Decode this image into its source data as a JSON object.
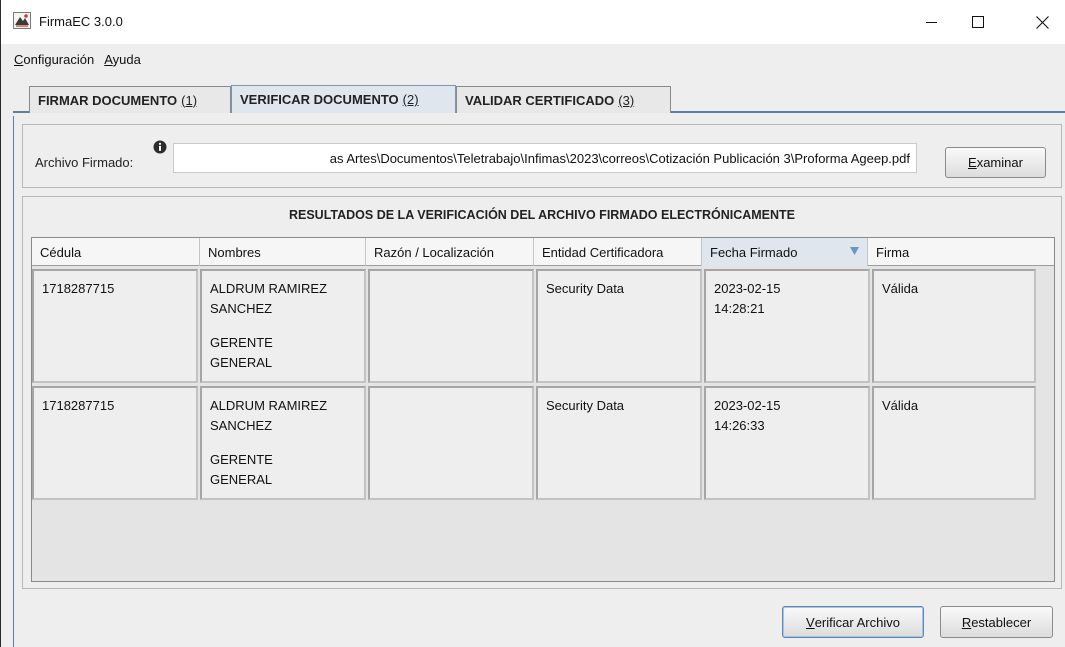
{
  "window": {
    "title": "FirmaEC 3.0.0"
  },
  "menu": {
    "items": [
      {
        "label_u": "C",
        "label_rest": "onfiguración"
      },
      {
        "label_u": "A",
        "label_rest": "yuda"
      }
    ]
  },
  "tabs": [
    {
      "label": "FIRMAR DOCUMENTO",
      "shortcut": "(1)"
    },
    {
      "label": "VERIFICAR DOCUMENTO",
      "shortcut": "(2)"
    },
    {
      "label": "VALIDAR CERTIFICADO",
      "shortcut": "(3)"
    }
  ],
  "file": {
    "label": "Archivo Firmado:",
    "value": "as Artes\\Documentos\\Teletrabajo\\Infimas\\2023\\correos\\Cotización Publicación 3\\Proforma Ageep.pdf",
    "browse_u": "E",
    "browse_rest": "xaminar"
  },
  "results": {
    "title": "RESULTADOS DE LA VERIFICACIÓN DEL ARCHIVO FIRMADO ELECTRÓNICAMENTE",
    "columns": [
      "Cédula",
      "Nombres",
      "Razón / Localización",
      "Entidad Certificadora",
      "Fecha Firmado",
      "Firma"
    ],
    "rows": [
      {
        "cedula": "1718287715",
        "nombres_1": "ALDRUM RAMIREZ",
        "nombres_2": "SANCHEZ",
        "nombres_3": "GERENTE",
        "nombres_4": "GENERAL",
        "razon": "",
        "entidad": "Security Data",
        "fecha_1": "2023-02-15",
        "fecha_2": "14:28:21",
        "firma": "Válida"
      },
      {
        "cedula": "1718287715",
        "nombres_1": "ALDRUM RAMIREZ",
        "nombres_2": "SANCHEZ",
        "nombres_3": "GERENTE",
        "nombres_4": "GENERAL",
        "razon": "",
        "entidad": "Security Data",
        "fecha_1": "2023-02-15",
        "fecha_2": "14:26:33",
        "firma": "Válida"
      }
    ]
  },
  "actions": {
    "verify_u": "V",
    "verify_rest": "erificar Archivo",
    "reset_u": "R",
    "reset_rest": "establecer"
  }
}
